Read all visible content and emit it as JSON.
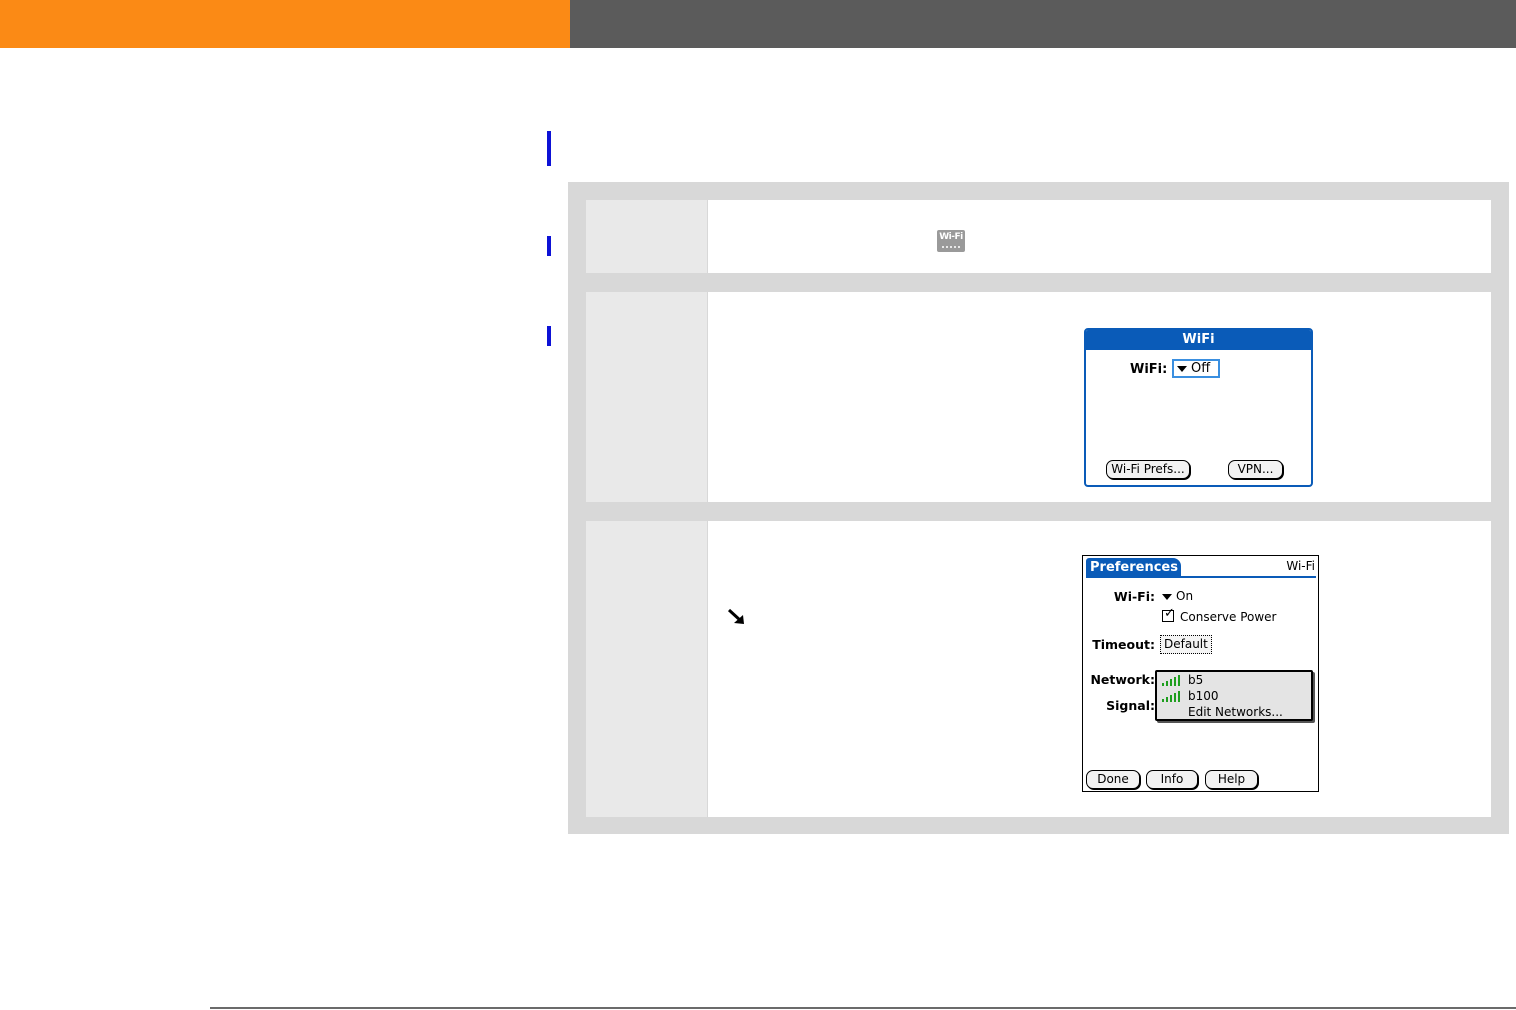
{
  "colors": {
    "orange_band": "#fb8a15",
    "gray_band": "#5b5b5b",
    "marker_blue": "#0d12d6",
    "palm_blue": "#0a5bb8",
    "signal_green": "#1e9e1e"
  },
  "icons": {
    "wifi_app_icon": "wifi-app-icon",
    "arrow": "down-right-arrow-icon"
  },
  "wifi_dialog": {
    "title": "WiFi",
    "wifi_label": "WiFi:",
    "wifi_value": "Off",
    "prefs_button": "Wi-Fi Prefs...",
    "vpn_button": "VPN..."
  },
  "wifi_app_icon_label": "Wi-Fi",
  "prefs_screen": {
    "tab_title": "Preferences",
    "category": "Wi-Fi",
    "wifi_label": "Wi-Fi:",
    "wifi_value": "On",
    "conserve_power": "Conserve Power",
    "conserve_checked": true,
    "timeout_label": "Timeout:",
    "timeout_value": "Default",
    "network_label": "Network:",
    "signal_label": "Signal:",
    "networks": [
      "b5",
      "b100"
    ],
    "edit_networks": "Edit Networks...",
    "buttons": [
      "Done",
      "Info",
      "Help"
    ]
  }
}
